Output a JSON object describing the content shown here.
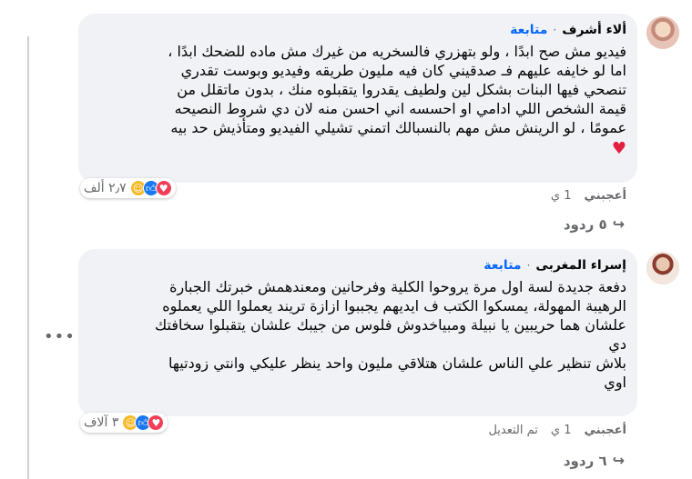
{
  "comments": [
    {
      "author": "ألاء أشرف",
      "follow": "متابعة",
      "separator": "·",
      "text": "فيديو مش صح ابدًا ، ولو بتهزري فالسخريه من غيرك مش ماده للضحك ابدًا ،\nاما لو خايفه عليهم فـ صدقيني كان فيه مليون طريقه وفيديو وبوست تقدري\nتنصحي فيها البنات بشكل لين ولطيف يقدروا يتقبلوه منك ، بدون ماتقلل من\nقيمة الشخص اللي ادامي او احسسه اني احسن منه لان دي شروط النصيحه\nعمومًا ، لو الرينش مش مهم بالنسبالك اتمني تشيلي الفيديو ومتأذيش حد بيه",
      "heart": "♥",
      "reaction_count": "٢٫٧ ألف",
      "reaction_icons": [
        "love-icon",
        "like-icon",
        "care-icon"
      ],
      "like_label": "أعجبني",
      "time": "1 ي",
      "replies_label": "٥ ردود",
      "edited_label": ""
    },
    {
      "author": "إسراء المغربى",
      "follow": "متابعة",
      "separator": "·",
      "text": "دفعة جديدة لسة اول مرة يروحوا الكلية وفرحانين ومعندهمش خبرتك الجبارة\nالرهيبة المهولة، يمسكوا الكتب ف ايديهم يجببوا ازازة تريند يعملوا اللي يعملوه\nعلشان هما حريبين يا نبيلة ومبياخدوش فلوس من جيبك علشان يتقبلوا سخافتك\nدي\nبلاش تنظير علي الناس علشان هتلاقي مليون واحد ينظر عليكي وانتي زودتيها\nاوي",
      "reaction_count": "٣ آلاف",
      "reaction_icons": [
        "love-icon",
        "like-icon",
        "care-icon"
      ],
      "like_label": "أعجبني",
      "time": "1 ي",
      "replies_label": "٦ ردود",
      "edited_label": "تم التعديل"
    }
  ],
  "more_options": "•••",
  "reply_arrow": "↪",
  "colors": {
    "bubble": "#f0f2f5",
    "follow": "#0866ff",
    "meta": "#65676b",
    "love": "#f33e58",
    "like": "#1877f2",
    "care": "#f7b928"
  }
}
